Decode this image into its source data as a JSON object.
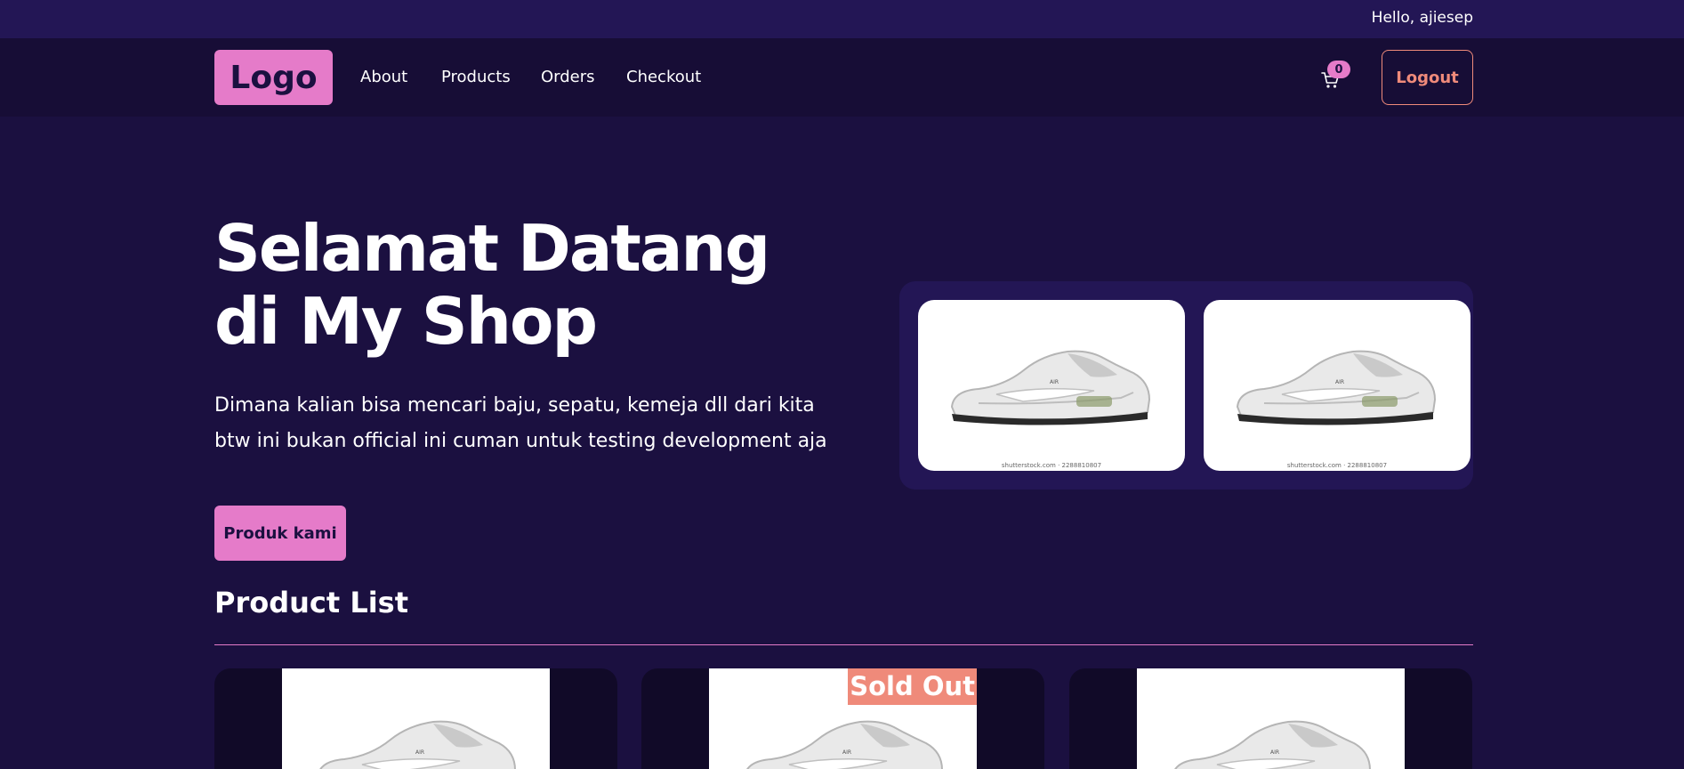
{
  "header": {
    "greeting": "Hello, ajiesep"
  },
  "nav": {
    "logo": "Logo",
    "links": [
      "About",
      "Products",
      "Orders",
      "Checkout"
    ],
    "cart_count": "0",
    "logout_label": "Logout"
  },
  "hero": {
    "title": "Selamat Datang di My Shop",
    "description_line1": "Dimana kalian bisa mencari baju, sepatu, kemeja dll dari kita",
    "description_line2": "btw ini bukan official ini cuman untuk testing development aja",
    "cta_label": "Produk kami"
  },
  "gallery": {
    "images": [
      "sneaker",
      "sneaker"
    ],
    "caption": "shutterstock.com · 2288810807"
  },
  "products": {
    "section_title": "Product List",
    "items": [
      {
        "image": "sneaker",
        "sold_out": false
      },
      {
        "image": "sneaker",
        "sold_out": true,
        "badge": "Sold Out"
      },
      {
        "image": "sneaker",
        "sold_out": false
      }
    ]
  },
  "colors": {
    "background": "#1b1040",
    "topbar": "#231655",
    "navbar": "#170d36",
    "accent_pink": "#e57bc9",
    "accent_coral": "#ef8a7a"
  },
  "icons": {
    "cart": "shopping-cart-icon"
  }
}
